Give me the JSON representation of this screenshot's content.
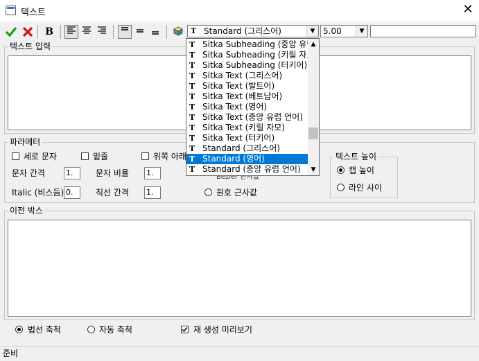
{
  "window": {
    "title": "텍스트",
    "close_glyph": "✕"
  },
  "toolbar": {
    "ok_icon": "check-icon",
    "cancel_icon": "x-icon",
    "bold": "B",
    "font_value": "Standard (그리스어)",
    "size_value": "5.00",
    "extra_value": ""
  },
  "font_dropdown": {
    "items": [
      "Sitka Subheading (중앙 유럽",
      "Sitka Subheading (키릴 자모",
      "Sitka Subheading (터키어)",
      "Sitka Text (그리스어)",
      "Sitka Text (발트어)",
      "Sitka Text (베트남어)",
      "Sitka Text (영어)",
      "Sitka Text (중앙 유럽 언어)",
      "Sitka Text (키릴 자모)",
      "Sitka Text (터키어)",
      "Standard (그리스어)",
      "Standard (영어)",
      "Standard (중앙 유럽 언어)"
    ],
    "selected_index": 11,
    "item_glyph": "T"
  },
  "text_input": {
    "legend": "텍스트 입력",
    "value": ""
  },
  "params": {
    "legend": "파라메터",
    "vertical_text": "세로 문자",
    "underline": "밑줄",
    "over_under": "위쪽 아래",
    "char_spacing_label": "문자 간격",
    "char_spacing_value": "1.",
    "char_ratio_label": "문자 비율",
    "char_ratio_value": "1.",
    "italic_label": "Italic (비스듬)",
    "italic_value": "0.",
    "line_spacing_label": "직선 간격",
    "line_spacing_value": "1.",
    "bezier_partial": "Bezier 근사값",
    "arc_approx": "원호 근사값"
  },
  "text_height": {
    "legend": "텍스트 높이",
    "cap_height": "캡 높이",
    "line_between": "라인 사이"
  },
  "preview": {
    "legend": "이전 박스",
    "value": ""
  },
  "bottom": {
    "normal_scale": "법선 축척",
    "auto_scale": "자동 축척",
    "regen_preview": "재 생성 미리보기"
  },
  "status": {
    "text": "준비"
  }
}
